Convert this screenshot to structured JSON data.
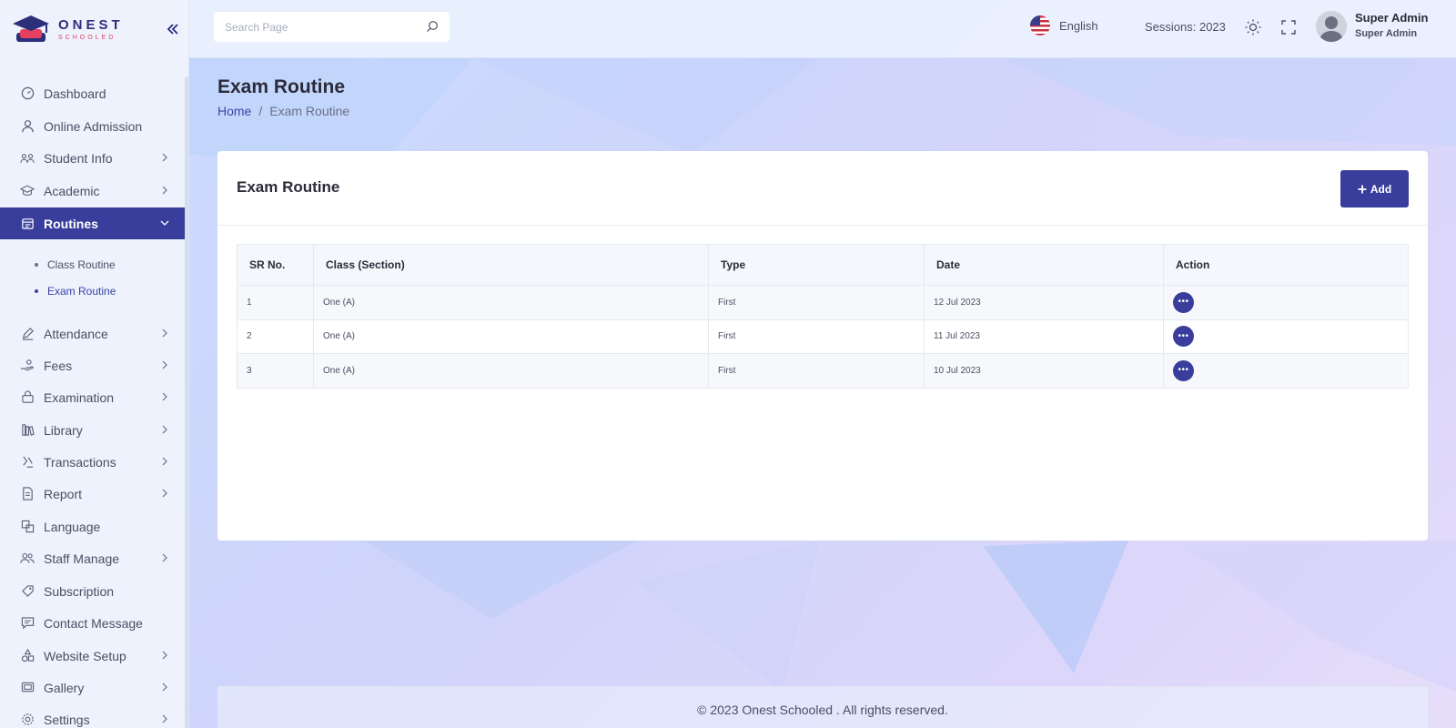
{
  "brand": {
    "name": "ONEST",
    "tagline": "SCHOOLED"
  },
  "search": {
    "placeholder": "Search Page"
  },
  "header": {
    "language": "English",
    "session": "Sessions: 2023",
    "user_name": "Super Admin",
    "user_role": "Super Admin"
  },
  "sidebar": {
    "items": [
      {
        "label": "Dashboard",
        "icon": "dashboard-icon"
      },
      {
        "label": "Online Admission",
        "icon": "user-icon"
      },
      {
        "label": "Student Info",
        "icon": "students-icon"
      },
      {
        "label": "Academic",
        "icon": "academic-cap-icon"
      },
      {
        "label": "Routines",
        "icon": "calendar-icon"
      },
      {
        "label": "Attendance",
        "icon": "pen-icon"
      },
      {
        "label": "Fees",
        "icon": "money-hand-icon"
      },
      {
        "label": "Examination",
        "icon": "exam-icon"
      },
      {
        "label": "Library",
        "icon": "library-icon"
      },
      {
        "label": "Transactions",
        "icon": "transactions-icon"
      },
      {
        "label": "Report",
        "icon": "report-icon"
      },
      {
        "label": "Language",
        "icon": "language-icon"
      },
      {
        "label": "Staff Manage",
        "icon": "staff-icon"
      },
      {
        "label": "Subscription",
        "icon": "tag-icon"
      },
      {
        "label": "Contact Message",
        "icon": "message-icon"
      },
      {
        "label": "Website Setup",
        "icon": "website-setup-icon"
      },
      {
        "label": "Gallery",
        "icon": "gallery-icon"
      },
      {
        "label": "Settings",
        "icon": "gear-icon"
      }
    ],
    "routines_sub": [
      {
        "label": "Class Routine"
      },
      {
        "label": "Exam Routine"
      }
    ]
  },
  "page": {
    "title": "Exam Routine",
    "breadcrumb_home": "Home",
    "breadcrumb_sep": "/",
    "breadcrumb_current": "Exam Routine"
  },
  "card": {
    "title": "Exam Routine",
    "add_label": "Add",
    "columns": [
      "SR No.",
      "Class (Section)",
      "Type",
      "Date",
      "Action"
    ],
    "rows": [
      {
        "sr": "1",
        "class": "One (A)",
        "type": "First",
        "date": "12 Jul 2023"
      },
      {
        "sr": "2",
        "class": "One (A)",
        "type": "First",
        "date": "11 Jul 2023"
      },
      {
        "sr": "3",
        "class": "One (A)",
        "type": "First",
        "date": "10 Jul 2023"
      }
    ]
  },
  "footer": {
    "text": "© 2023 Onest Schooled . All rights reserved."
  },
  "colors": {
    "primary": "#393e9c",
    "accent": "#e4405f"
  }
}
